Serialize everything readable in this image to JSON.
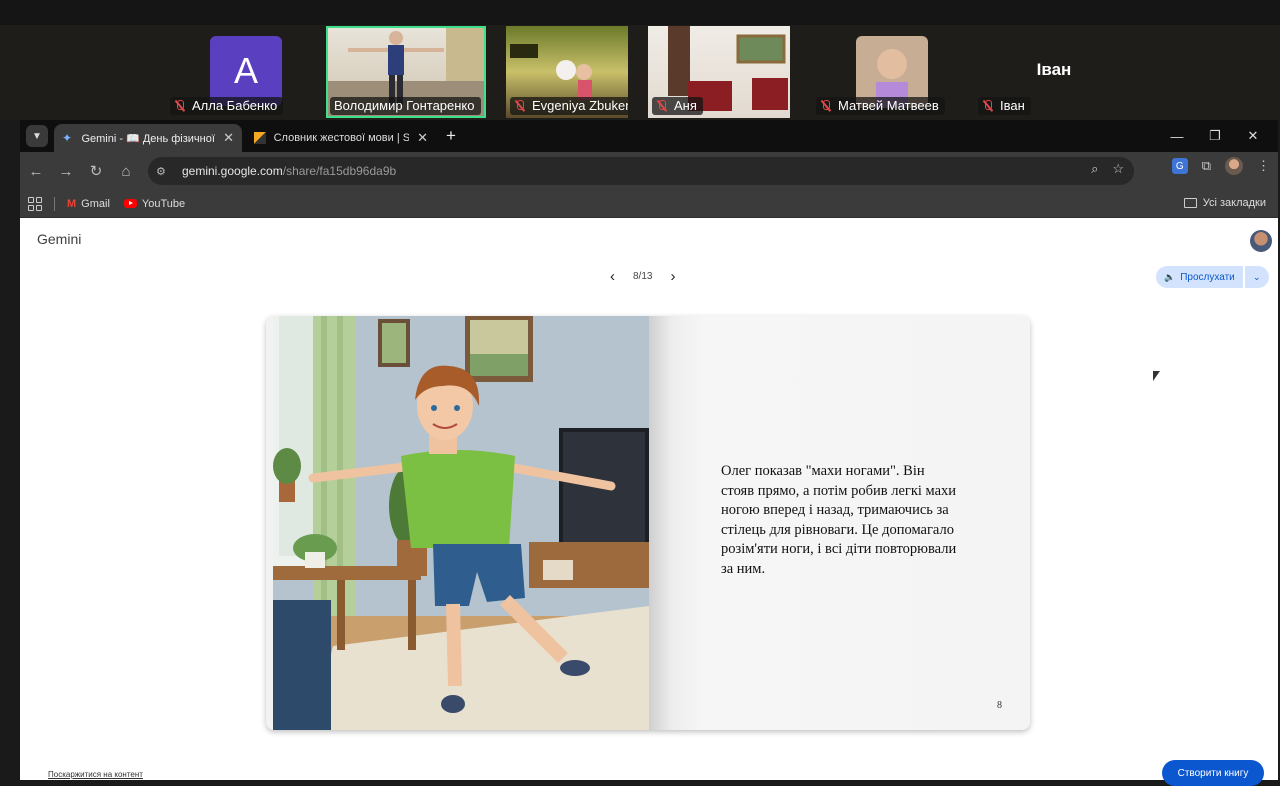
{
  "conference": {
    "participants": [
      {
        "name": "Алла Бабенко",
        "initial": "A",
        "muted": true
      },
      {
        "name": "Володимир Гонтаренко",
        "muted": false,
        "speaking": true
      },
      {
        "name": "Evgeniya Zbuker",
        "muted": true
      },
      {
        "name": "Аня",
        "muted": true
      },
      {
        "name": "Матвей Матвеев",
        "muted": true
      },
      {
        "name": "Іван",
        "muted": true,
        "big_label": "Іван"
      }
    ]
  },
  "browser": {
    "tabs": [
      {
        "title": "Gemini - 📖 День фізичної культури",
        "active": true
      },
      {
        "title": "Словник жестової мови | Spreadsheet",
        "active": false
      }
    ],
    "url_host": "gemini.google.com",
    "url_path": "/share/fa15db96da9b",
    "bookmarks": [
      {
        "label": "Gmail",
        "icon": "gmail-icon"
      },
      {
        "label": "YouTube",
        "icon": "youtube-icon"
      }
    ],
    "all_bookmarks_label": "Усі закладки"
  },
  "page": {
    "brand": "Gemini",
    "pager": "8/13",
    "listen_label": "Прослухати",
    "story_text": "Олег показав \"махи ногами\". Він стояв прямо, а потім робив легкі махи ногою вперед і назад, тримаючись за стілець для рівноваги. Це допомагало розім'яти ноги, і всі діти повторювали за ним.",
    "page_number": "8",
    "report_link": "Поскаржитися на контент",
    "create_button": "Створити книгу"
  },
  "colors": {
    "speaking_outline": "#3fe08c",
    "accent_blue": "#0b57d0",
    "listen_bg": "#d3e3fd",
    "muted_red": "#e04848"
  }
}
